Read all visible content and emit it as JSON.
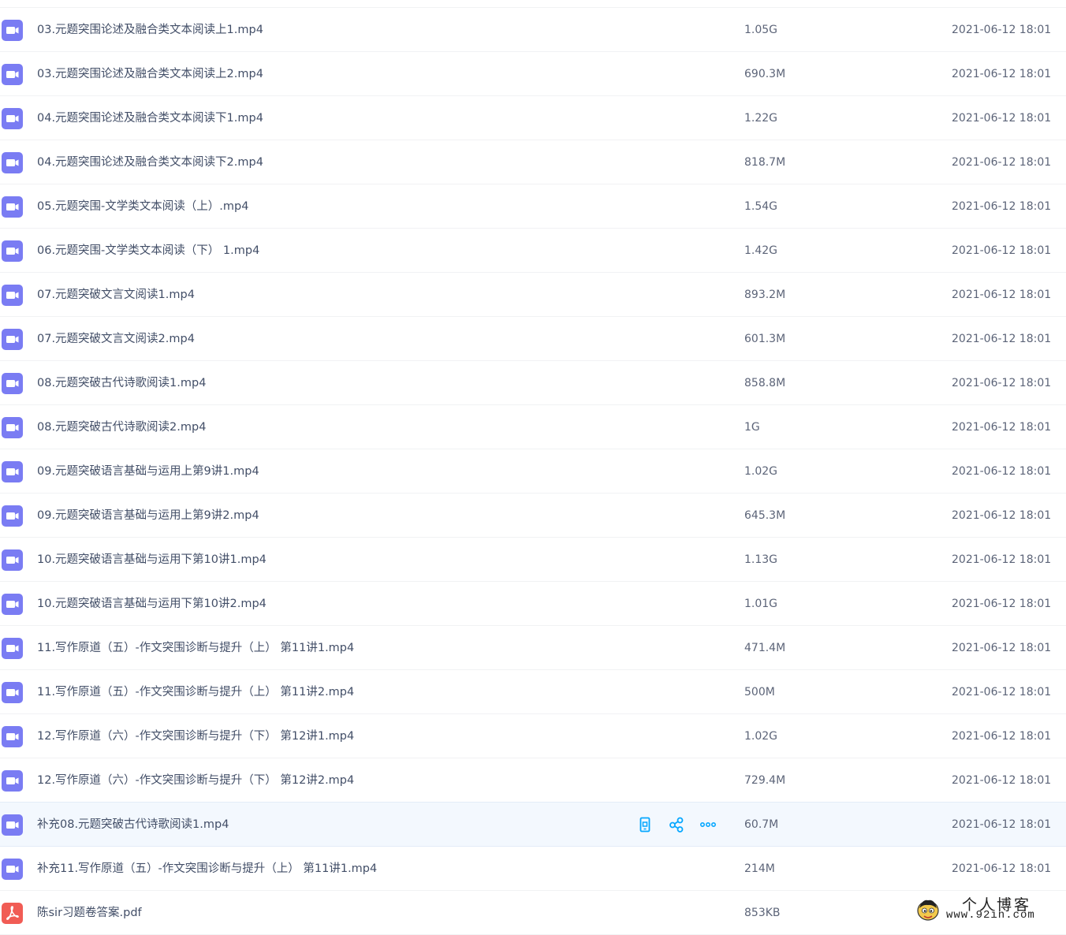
{
  "files": [
    {
      "name": "03.元题突围论述及融合类文本阅读上1.mp4",
      "size": "1.05G",
      "date": "2021-06-12 18:01",
      "icon": "video-file-icon"
    },
    {
      "name": "03.元题突围论述及融合类文本阅读上2.mp4",
      "size": "690.3M",
      "date": "2021-06-12 18:01",
      "icon": "video-file-icon"
    },
    {
      "name": "04.元题突围论述及融合类文本阅读下1.mp4",
      "size": "1.22G",
      "date": "2021-06-12 18:01",
      "icon": "video-file-icon"
    },
    {
      "name": "04.元题突围论述及融合类文本阅读下2.mp4",
      "size": "818.7M",
      "date": "2021-06-12 18:01",
      "icon": "video-file-icon"
    },
    {
      "name": "05.元题突围-文学类文本阅读（上）.mp4",
      "size": "1.54G",
      "date": "2021-06-12 18:01",
      "icon": "video-file-icon"
    },
    {
      "name": "06.元题突围-文学类文本阅读（下） 1.mp4",
      "size": "1.42G",
      "date": "2021-06-12 18:01",
      "icon": "video-file-icon"
    },
    {
      "name": "07.元题突破文言文阅读1.mp4",
      "size": "893.2M",
      "date": "2021-06-12 18:01",
      "icon": "video-file-icon"
    },
    {
      "name": "07.元题突破文言文阅读2.mp4",
      "size": "601.3M",
      "date": "2021-06-12 18:01",
      "icon": "video-file-icon"
    },
    {
      "name": "08.元题突破古代诗歌阅读1.mp4",
      "size": "858.8M",
      "date": "2021-06-12 18:01",
      "icon": "video-file-icon"
    },
    {
      "name": "08.元题突破古代诗歌阅读2.mp4",
      "size": "1G",
      "date": "2021-06-12 18:01",
      "icon": "video-file-icon"
    },
    {
      "name": "09.元题突破语言基础与运用上第9讲1.mp4",
      "size": "1.02G",
      "date": "2021-06-12 18:01",
      "icon": "video-file-icon"
    },
    {
      "name": "09.元题突破语言基础与运用上第9讲2.mp4",
      "size": "645.3M",
      "date": "2021-06-12 18:01",
      "icon": "video-file-icon"
    },
    {
      "name": "10.元题突破语言基础与运用下第10讲1.mp4",
      "size": "1.13G",
      "date": "2021-06-12 18:01",
      "icon": "video-file-icon"
    },
    {
      "name": "10.元题突破语言基础与运用下第10讲2.mp4",
      "size": "1.01G",
      "date": "2021-06-12 18:01",
      "icon": "video-file-icon"
    },
    {
      "name": "11.写作原道（五）-作文突围诊断与提升（上） 第11讲1.mp4",
      "size": "471.4M",
      "date": "2021-06-12 18:01",
      "icon": "video-file-icon"
    },
    {
      "name": "11.写作原道（五）-作文突围诊断与提升（上） 第11讲2.mp4",
      "size": "500M",
      "date": "2021-06-12 18:01",
      "icon": "video-file-icon"
    },
    {
      "name": "12.写作原道（六）-作文突围诊断与提升（下） 第12讲1.mp4",
      "size": "1.02G",
      "date": "2021-06-12 18:01",
      "icon": "video-file-icon"
    },
    {
      "name": "12.写作原道（六）-作文突围诊断与提升（下） 第12讲2.mp4",
      "size": "729.4M",
      "date": "2021-06-12 18:01",
      "icon": "video-file-icon"
    },
    {
      "name": "补充08.元题突破古代诗歌阅读1.mp4",
      "size": "60.7M",
      "date": "2021-06-12 18:01",
      "icon": "video-file-icon",
      "hovered": true
    },
    {
      "name": "补充11.写作原道（五）-作文突围诊断与提升（上） 第11讲1.mp4",
      "size": "214M",
      "date": "2021-06-12 18:01",
      "icon": "video-file-icon"
    },
    {
      "name": "陈sir习题卷答案.pdf",
      "size": "853KB",
      "date": "",
      "icon": "pdf-file-icon"
    }
  ],
  "hover_actions": [
    {
      "icon": "phone-icon"
    },
    {
      "icon": "share-icon"
    },
    {
      "icon": "more-icon"
    }
  ],
  "watermark": {
    "title": "个人博客",
    "url": "www.92in.com"
  },
  "colors": {
    "accent": "#06a7ff",
    "video_icon": "#7a7cf3",
    "pdf_icon": "#f15c55",
    "hover_row": "#f3f8fe",
    "text": "#424e67"
  }
}
